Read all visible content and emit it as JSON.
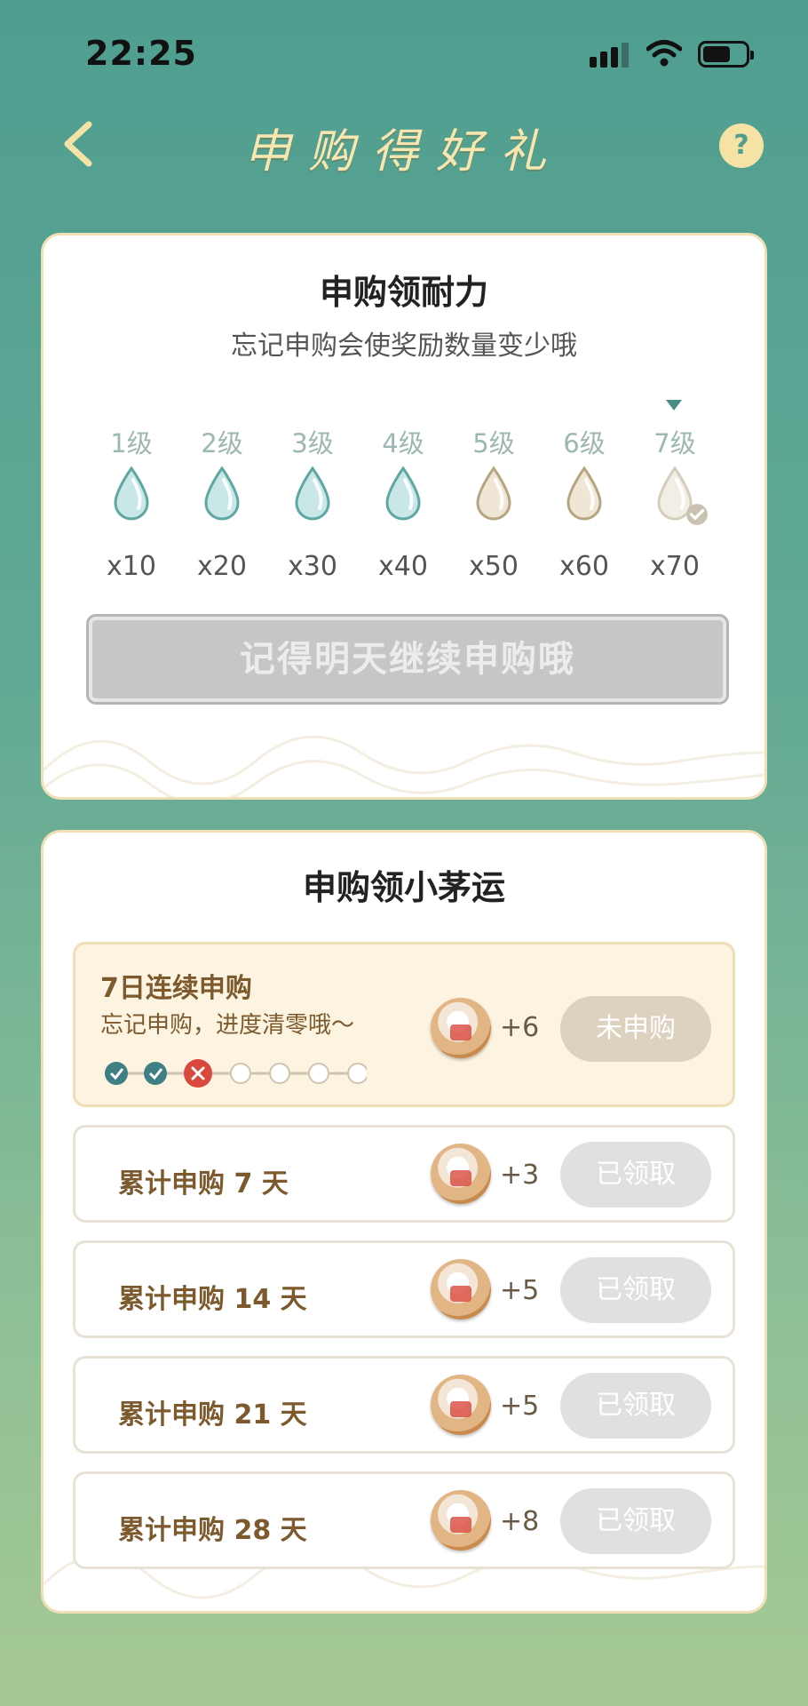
{
  "status_bar": {
    "time": "22:25"
  },
  "nav": {
    "title": "申购得好礼",
    "help": "?"
  },
  "endurance": {
    "title": "申购领耐力",
    "subtitle": "忘记申购会使奖励数量变少哦",
    "current_level_index": 6,
    "levels": [
      {
        "label": "1级",
        "count": "x10",
        "state": "teal"
      },
      {
        "label": "2级",
        "count": "x20",
        "state": "teal"
      },
      {
        "label": "3级",
        "count": "x30",
        "state": "teal"
      },
      {
        "label": "4级",
        "count": "x40",
        "state": "teal"
      },
      {
        "label": "5级",
        "count": "x50",
        "state": "tan"
      },
      {
        "label": "6级",
        "count": "x60",
        "state": "tan"
      },
      {
        "label": "7级",
        "count": "x70",
        "state": "current"
      }
    ],
    "button_label": "记得明天继续申购哦"
  },
  "luck": {
    "title": "申购领小茅运",
    "streak": {
      "title": "7日连续申购",
      "subtitle": "忘记申购，进度清零哦～",
      "days": [
        "done",
        "done",
        "missed",
        "empty",
        "empty",
        "empty",
        "empty"
      ],
      "amount": "+6",
      "button": "未申购"
    },
    "rows": [
      {
        "label": "累计申购 7 天",
        "amount": "+3",
        "button": "已领取"
      },
      {
        "label": "累计申购 14 天",
        "amount": "+5",
        "button": "已领取"
      },
      {
        "label": "累计申购 21 天",
        "amount": "+5",
        "button": "已领取"
      },
      {
        "label": "累计申购 28 天",
        "amount": "+8",
        "button": "已领取"
      }
    ]
  },
  "colors": {
    "teal": "#4f9e90",
    "gold": "#f7e6b0",
    "brown": "#7c5a2e",
    "red": "#d9483d"
  }
}
